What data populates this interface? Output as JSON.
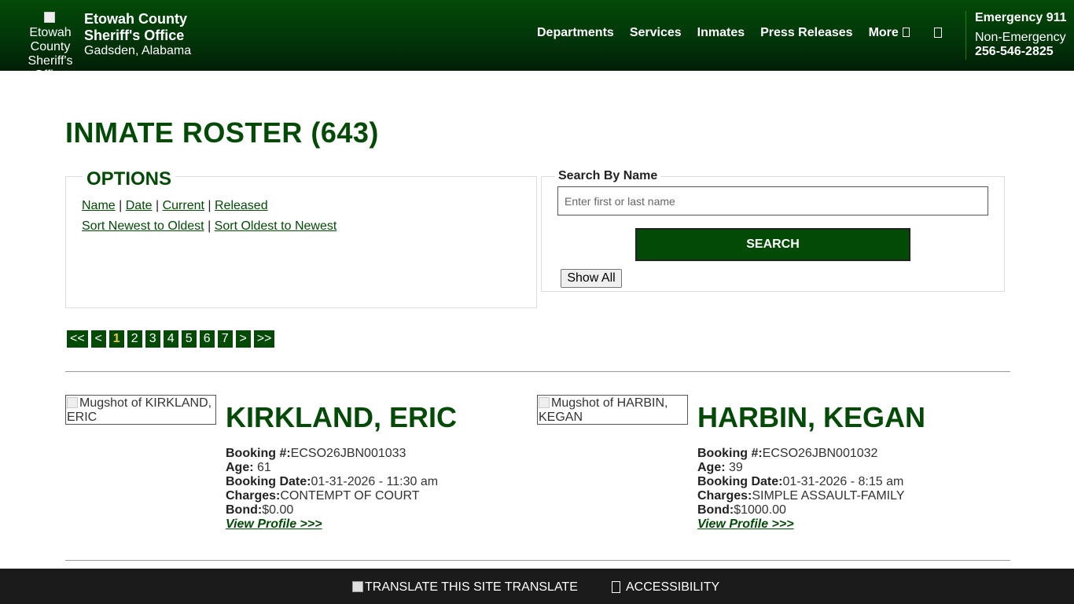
{
  "header": {
    "logo_alt": "Etowah County Sheriff's Office",
    "site_name_line1": "Etowah County",
    "site_name_line2": "Sheriff's Office",
    "site_sub": "Gadsden, Alabama",
    "nav": [
      "Departments",
      "Services",
      "Inmates",
      "Press Releases",
      "More"
    ],
    "search_icon": "search-icon",
    "emergency": "Emergency 911",
    "non_emergency_label": "Non-Emergency",
    "non_emergency_number": "256-546-2825"
  },
  "main": {
    "title": "INMATE ROSTER (643)",
    "options": {
      "legend": "OPTIONS",
      "sort_by": [
        "Name",
        "Date",
        "Current",
        "Released"
      ],
      "order": [
        "Sort Newest to Oldest",
        "Sort Oldest to Newest"
      ]
    },
    "search": {
      "legend": "Search By Name",
      "placeholder": "Enter first or last name",
      "value": "",
      "button": "SEARCH",
      "show_all": "Show All"
    },
    "pagination": {
      "items": [
        "<<",
        "<",
        "1",
        "2",
        "3",
        "4",
        "5",
        "6",
        "7",
        ">",
        ">>"
      ],
      "current": "1"
    },
    "inmates": [
      {
        "mugshot_alt": "Mugshot of KIRKLAND, ERIC",
        "name": "KIRKLAND, ERIC",
        "booking_label": "Booking #:",
        "booking": "ECSO26JBN001033",
        "age_label": "Age:",
        "age": "61",
        "date_label": "Booking Date:",
        "date": "01-31-2026 - 11:30 am",
        "charges_label": "Charges:",
        "charges": "CONTEMPT OF COURT",
        "bond_label": "Bond:",
        "bond": "$0.00",
        "link": "View Profile >>>"
      },
      {
        "mugshot_alt": "Mugshot of HARBIN, KEGAN",
        "name": "HARBIN, KEGAN",
        "booking_label": "Booking #:",
        "booking": "ECSO26JBN001032",
        "age_label": "Age:",
        "age": "39",
        "date_label": "Booking Date:",
        "date": "01-31-2026 - 8:15 am",
        "charges_label": "Charges:",
        "charges": "SIMPLE ASSAULT-FAMILY",
        "bond_label": "Bond:",
        "bond": "$1000.00",
        "link": "View Profile >>>"
      }
    ]
  },
  "footer": {
    "translate": "TRANSLATE THIS SITE TRANSLATE",
    "accessibility": "ACCESSIBILITY"
  },
  "colors": {
    "brand_green": "#034a06",
    "active_page": "#e7c547",
    "footer_bg": "#1b1b1b"
  }
}
